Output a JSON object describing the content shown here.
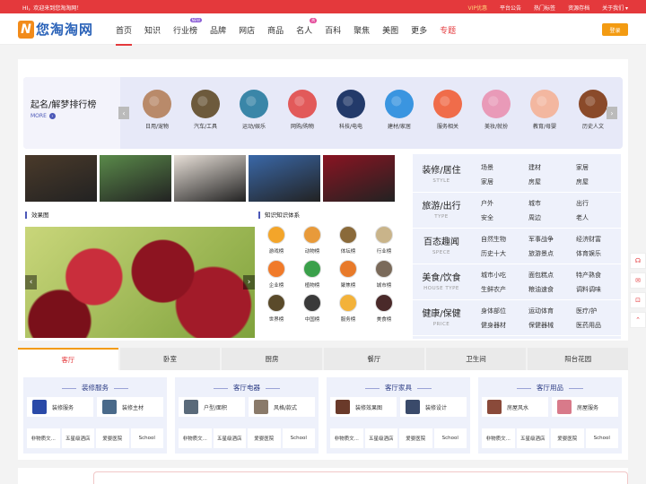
{
  "topbar": {
    "welcome": "HI，欢迎来到您淘淘网！",
    "links": [
      "VIP优惠",
      "平台公告",
      "热门标签",
      "资源存档",
      "关于我们 ▾"
    ]
  },
  "logo": {
    "mark": "N",
    "text": "您淘淘网"
  },
  "nav": [
    {
      "label": "首页",
      "active": true
    },
    {
      "label": "知识"
    },
    {
      "label": "行业榜",
      "badge": "NEW"
    },
    {
      "label": "品牌"
    },
    {
      "label": "网店"
    },
    {
      "label": "商品"
    },
    {
      "label": "名人",
      "badge": "热"
    },
    {
      "label": "百科"
    },
    {
      "label": "聚焦"
    },
    {
      "label": "美图"
    },
    {
      "label": "更多"
    },
    {
      "label": "专题",
      "special": true
    }
  ],
  "login_label": "登录",
  "rank": {
    "title": "起名/解梦排行榜",
    "more": "MORE",
    "categories": [
      "日用/宠物",
      "汽车/工具",
      "运动/娱乐",
      "网购/购物",
      "科技/电电",
      "建材/家居",
      "服务相关",
      "美妆/就扮",
      "教育/母婴",
      "历史人文"
    ],
    "colors": [
      "#b98a6a",
      "#6d5a3c",
      "#3a86a8",
      "#e25a5a",
      "#233a6a",
      "#3a95e0",
      "#f06c4a",
      "#e99ab8",
      "#f3b7a0",
      "#8a4a2a"
    ]
  },
  "photo_colors": [
    "#4a3a2a",
    "#5a8a4a",
    "#e8e0d8",
    "#3a68a8",
    "#8a1422"
  ],
  "sections": {
    "gallery": "效果图",
    "knowledge": "知识知识体系"
  },
  "knowledge": [
    {
      "label": "游戏榜",
      "color": "#f3a52a"
    },
    {
      "label": "动物榜",
      "color": "#e89a3a"
    },
    {
      "label": "体坛榜",
      "color": "#8a6a3a"
    },
    {
      "label": "行业榜",
      "color": "#c9b48a"
    },
    {
      "label": "企业榜",
      "color": "#f07a2a"
    },
    {
      "label": "植物榜",
      "color": "#3aa04a"
    },
    {
      "label": "聚焦榜",
      "color": "#e87a2a"
    },
    {
      "label": "城市榜",
      "color": "#7a6a5a"
    },
    {
      "label": "世界榜",
      "color": "#5a4a2a"
    },
    {
      "label": "中国榜",
      "color": "#3a3a3a"
    },
    {
      "label": "服务榜",
      "color": "#f3b23a"
    },
    {
      "label": "美食榜",
      "color": "#4a2a2a"
    }
  ],
  "right_rows": [
    {
      "cn": "装修/居住",
      "en": "STYLE",
      "vals": [
        "场景",
        "建材",
        "家居",
        "家居",
        "房屋",
        "房屋"
      ]
    },
    {
      "cn": "旅游/出行",
      "en": "TYPE",
      "vals": [
        "户外",
        "城市",
        "出行",
        "安全",
        "周边",
        "老人"
      ]
    },
    {
      "cn": "百态趣闻",
      "en": "SPECE",
      "vals": [
        "自然生物",
        "军事战争",
        "经济财富",
        "历史十大",
        "旅游景点",
        "体育娱乐"
      ]
    },
    {
      "cn": "美食/饮食",
      "en": "HOUSE TYPE",
      "vals": [
        "城市小吃",
        "面包糕点",
        "特产熟食",
        "生鲜农产",
        "粮油速食",
        "调料调味"
      ]
    },
    {
      "cn": "健康/保健",
      "en": "PRICE",
      "vals": [
        "身体部位",
        "运动体育",
        "医疗/护",
        "健身器材",
        "保健器械",
        "医药用品"
      ]
    }
  ],
  "tabs": [
    {
      "label": "客厅",
      "active": true
    },
    {
      "label": "卧室"
    },
    {
      "label": "厨房"
    },
    {
      "label": "餐厅"
    },
    {
      "label": "卫生间"
    },
    {
      "label": "阳台花园"
    }
  ],
  "panels": [
    {
      "title": "装修服务",
      "items": [
        {
          "label": "装修服务",
          "color": "#2a4aa8"
        },
        {
          "label": "装修主材",
          "color": "#4a6a8a"
        }
      ],
      "links": [
        "非物质文...",
        "五星级酒店",
        "爱婴医院",
        "School"
      ]
    },
    {
      "title": "客厅电器",
      "items": [
        {
          "label": "户型/面积",
          "color": "#5a6a7a"
        },
        {
          "label": "风格/款式",
          "color": "#8a7a6a"
        }
      ],
      "links": [
        "非物质文...",
        "五星级酒店",
        "爱婴医院",
        "School"
      ]
    },
    {
      "title": "客厅家具",
      "items": [
        {
          "label": "装修效果图",
          "color": "#6a3a2a"
        },
        {
          "label": "装修设计",
          "color": "#3a4a6a"
        }
      ],
      "links": [
        "非物质文...",
        "五星级酒店",
        "爱婴医院",
        "School"
      ]
    },
    {
      "title": "客厅用品",
      "items": [
        {
          "label": "房屋风水",
          "color": "#8a4a3a"
        },
        {
          "label": "房屋服务",
          "color": "#d87a8a"
        }
      ],
      "links": [
        "非物质文...",
        "五星级酒店",
        "爱婴医院",
        "School"
      ]
    }
  ],
  "float_icons": [
    "headset-icon",
    "chat-icon",
    "cart-icon",
    "top-icon"
  ]
}
